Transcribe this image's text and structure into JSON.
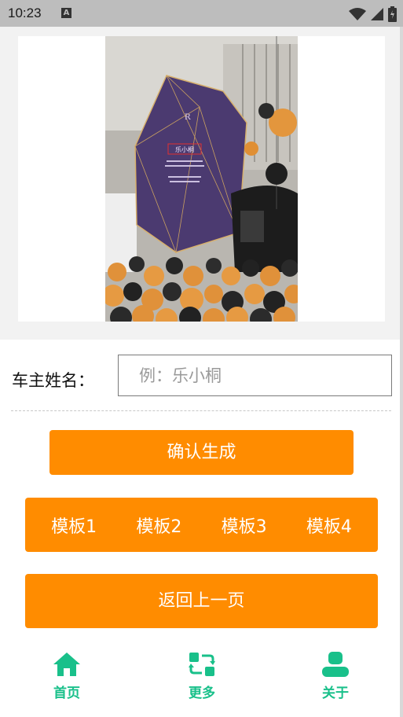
{
  "status_bar": {
    "time": "10:23",
    "notification_glyph": "A",
    "icons": [
      "wifi-icon",
      "signal-icon",
      "battery-icon"
    ]
  },
  "preview": {
    "image": "rolls-royce-celebration-photo",
    "name_on_board": "乐小桐"
  },
  "form": {
    "owner_label": "车主姓名：",
    "name_value": "",
    "name_placeholder": "例：乐小桐"
  },
  "buttons": {
    "confirm_label": "确认生成",
    "templates": [
      "模板1",
      "模板2",
      "模板3",
      "模板4"
    ],
    "back_label": "返回上一页"
  },
  "bottom_nav": {
    "items": [
      {
        "label": "首页",
        "icon": "home-icon"
      },
      {
        "label": "更多",
        "icon": "refresh-icon"
      },
      {
        "label": "关于",
        "icon": "user-icon"
      }
    ]
  },
  "colors": {
    "accent": "#ff8c00",
    "nav": "#19c08a",
    "status_bar": "#bdbdbd",
    "panel_bg": "#f2f2f2"
  }
}
